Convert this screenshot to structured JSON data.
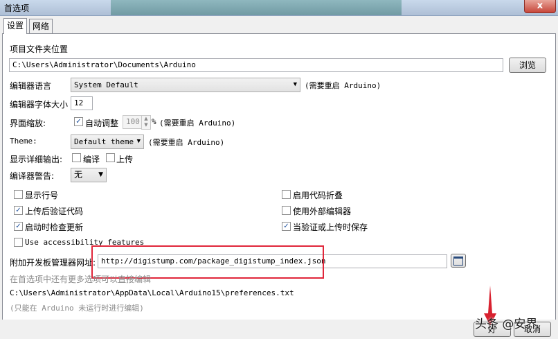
{
  "window": {
    "title": "首选项",
    "close_label": "x"
  },
  "tabs": [
    {
      "label": "设置"
    },
    {
      "label": "网络"
    }
  ],
  "sketchbook": {
    "label": "项目文件夹位置",
    "path": "C:\\Users\\Administrator\\Documents\\Arduino",
    "browse_label": "浏览"
  },
  "editor_language": {
    "label": "编辑器语言",
    "value": "System Default",
    "note": "(需要重启 Arduino)"
  },
  "font_size": {
    "label": "编辑器字体大小",
    "value": "12"
  },
  "interface_scale": {
    "label": "界面缩放:",
    "auto_label": "自动调整",
    "auto_checked": true,
    "value": "100",
    "unit": "%",
    "note": "(需要重启 Arduino)"
  },
  "theme": {
    "label": "Theme:",
    "value": "Default theme",
    "note": "(需要重启 Arduino)"
  },
  "verbose": {
    "label": "显示详细输出:",
    "compile_label": "编译",
    "upload_label": "上传"
  },
  "compiler_warnings": {
    "label": "编译器警告:",
    "value": "无"
  },
  "options_left": [
    {
      "label": "显示行号",
      "checked": false
    },
    {
      "label": "上传后验证代码",
      "checked": true
    },
    {
      "label": "启动时检查更新",
      "checked": true
    },
    {
      "label": "Use accessibility features",
      "checked": false
    }
  ],
  "options_right": [
    {
      "label": "启用代码折叠",
      "checked": false
    },
    {
      "label": "使用外部编辑器",
      "checked": false
    },
    {
      "label": "当验证或上传时保存",
      "checked": true
    }
  ],
  "board_manager": {
    "label": "附加开发板管理器网址:",
    "url": "http://digistump.com/package_digistump_index.json"
  },
  "more_prefs_note": "在首选项中还有更多选项可以直接编辑",
  "prefs_path": "C:\\Users\\Administrator\\AppData\\Local\\Arduino15\\preferences.txt",
  "edit_note": "(只能在 Arduino 未运行时进行编辑)",
  "buttons": {
    "ok": "好",
    "cancel": "取消"
  },
  "watermark": "头条 @安界",
  "colors": {
    "highlight": "#e0263a",
    "arrow": "#d8212f"
  }
}
